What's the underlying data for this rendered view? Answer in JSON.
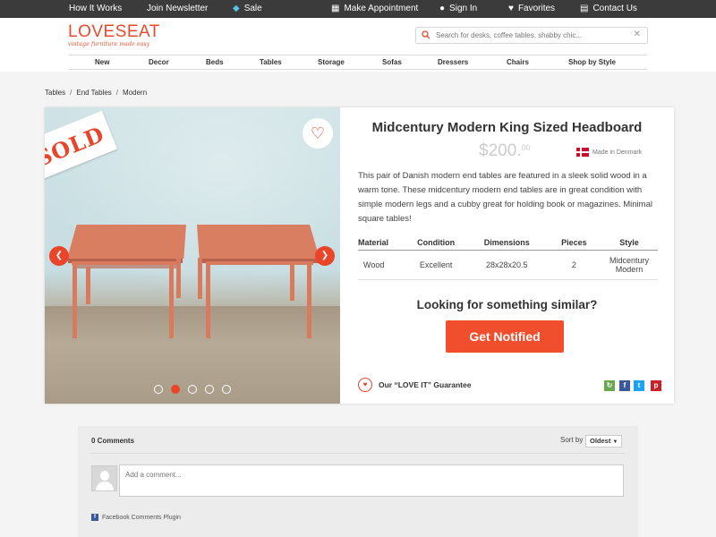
{
  "topbar": {
    "items": [
      {
        "label": "How It Works",
        "icon": ""
      },
      {
        "label": "Join Newsletter",
        "icon": ""
      },
      {
        "label": "Sale",
        "icon": "tag-icon"
      },
      {
        "label": "Make Appointment",
        "icon": "calendar-icon"
      },
      {
        "label": "Sign In",
        "icon": "user-icon"
      },
      {
        "label": "Favorites",
        "icon": "heart-icon"
      },
      {
        "label": "Contact Us",
        "icon": "card-icon"
      }
    ]
  },
  "brand": {
    "name": "LOVESEAT",
    "tagline": "vintage furniture made easy",
    "color": "#e84a2c"
  },
  "search": {
    "placeholder": "Search for desks, coffee tables, shabby chic..."
  },
  "nav": {
    "items": [
      "New",
      "Decor",
      "Beds",
      "Tables",
      "Storage",
      "Sofas",
      "Dressers",
      "Chairs",
      "Shop by Style"
    ]
  },
  "breadcrumb": [
    "Tables",
    "End Tables",
    "Modern"
  ],
  "product": {
    "sold_label": "SOLD",
    "title": "Midcentury Modern King Sized Headboard",
    "price": "$200.",
    "price_cents": "00",
    "made_in": "Made in Denmark",
    "description": "This pair of Danish modern end tables are featured in a sleek solid wood in a warm tone. These midcentury modern end tables are in great condition with simple modern legs and a cubby great for holding book or magazines. Minimal square tables!",
    "spec_headers": [
      "Material",
      "Condition",
      "Dimensions",
      "Pieces",
      "Style"
    ],
    "spec_values": [
      "Wood",
      "Excellent",
      "28x28x20.5",
      "2",
      "Midcentury Modern"
    ],
    "similar_heading": "Looking for something similar?",
    "notify_label": "Get Notified",
    "guarantee_label": "Our “LOVE IT” Guarantee",
    "carousel": {
      "count": 5,
      "active_index": 1
    },
    "accent_color": "#f04e2c"
  },
  "comments": {
    "count_label": "0 Comments",
    "sort_label": "Sort by",
    "sort_value": "Oldest",
    "placeholder": "Add a comment...",
    "plugin_label": "Facebook Comments Plugin"
  }
}
